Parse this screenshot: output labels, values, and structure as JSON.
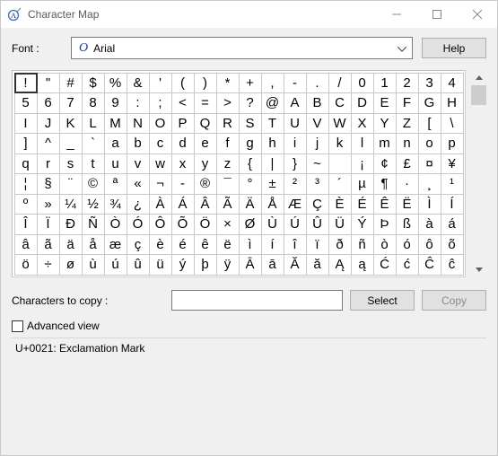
{
  "window": {
    "title": "Character Map"
  },
  "font_row": {
    "label": "Font :",
    "selected_font": "Arial",
    "help_button": "Help"
  },
  "grid": {
    "rows": [
      [
        "!",
        "\"",
        "#",
        "$",
        "%",
        "&",
        "'",
        "(",
        ")",
        "*",
        "+",
        ",",
        "-",
        ".",
        "/",
        "0",
        "1",
        "2",
        "3",
        "4"
      ],
      [
        "5",
        "6",
        "7",
        "8",
        "9",
        ":",
        ";",
        "<",
        "=",
        ">",
        "?",
        "@",
        "A",
        "B",
        "C",
        "D",
        "E",
        "F",
        "G",
        "H"
      ],
      [
        "I",
        "J",
        "K",
        "L",
        "M",
        "N",
        "O",
        "P",
        "Q",
        "R",
        "S",
        "T",
        "U",
        "V",
        "W",
        "X",
        "Y",
        "Z",
        "[",
        "\\"
      ],
      [
        "]",
        "^",
        "_",
        "`",
        "a",
        "b",
        "c",
        "d",
        "e",
        "f",
        "g",
        "h",
        "i",
        "j",
        "k",
        "l",
        "m",
        "n",
        "o",
        "p"
      ],
      [
        "q",
        "r",
        "s",
        "t",
        "u",
        "v",
        "w",
        "x",
        "y",
        "z",
        "{",
        "|",
        "}",
        "~",
        " ",
        "¡",
        "¢",
        "£",
        "¤",
        "¥"
      ],
      [
        "¦",
        "§",
        "¨",
        "©",
        "ª",
        "«",
        "¬",
        "-",
        "®",
        "¯",
        "°",
        "±",
        "²",
        "³",
        "´",
        "µ",
        "¶",
        "·",
        "¸",
        "¹"
      ],
      [
        "º",
        "»",
        "¼",
        "½",
        "¾",
        "¿",
        "À",
        "Á",
        "Â",
        "Ã",
        "Ä",
        "Å",
        "Æ",
        "Ç",
        "È",
        "É",
        "Ê",
        "Ë",
        "Ì",
        "Í"
      ],
      [
        "Î",
        "Ï",
        "Ð",
        "Ñ",
        "Ò",
        "Ó",
        "Ô",
        "Õ",
        "Ö",
        "×",
        "Ø",
        "Ù",
        "Ú",
        "Û",
        "Ü",
        "Ý",
        "Þ",
        "ß",
        "à",
        "á"
      ],
      [
        "â",
        "ã",
        "ä",
        "å",
        "æ",
        "ç",
        "è",
        "é",
        "ê",
        "ë",
        "ì",
        "í",
        "î",
        "ï",
        "ð",
        "ñ",
        "ò",
        "ó",
        "ô",
        "õ"
      ],
      [
        "ö",
        "÷",
        "ø",
        "ù",
        "ú",
        "û",
        "ü",
        "ý",
        "þ",
        "ÿ",
        "Ā",
        "ā",
        "Ă",
        "ă",
        "Ą",
        "ą",
        "Ć",
        "ć",
        "Ĉ",
        "ĉ"
      ]
    ],
    "selected_index": 0
  },
  "copy_row": {
    "label": "Characters to copy :",
    "value": "",
    "select_button": "Select",
    "copy_button": "Copy"
  },
  "advanced": {
    "label": "Advanced view",
    "checked": false
  },
  "status": {
    "text": "U+0021: Exclamation Mark"
  }
}
